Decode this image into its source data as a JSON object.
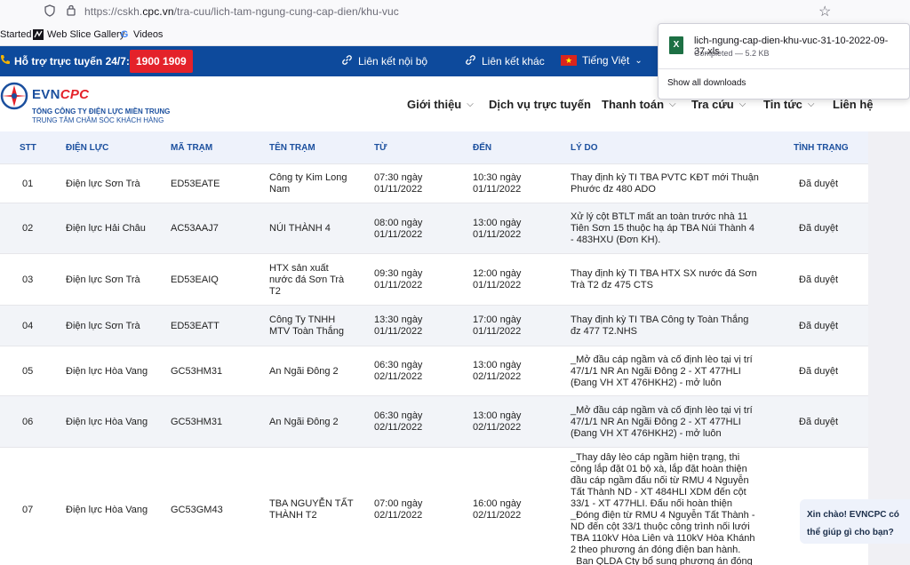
{
  "browser": {
    "url_prefix": "https://cskh.",
    "url_domain": "cpc.vn",
    "url_path": "/tra-cuu/lich-tam-ngung-cung-cap-dien/khu-vuc",
    "bookmarks": [
      {
        "label": "Started",
        "icon": "bookmark-icon"
      },
      {
        "label": "Web Slice Gallery",
        "icon": "web-slice-icon"
      },
      {
        "label": "Videos",
        "icon": "google-icon"
      }
    ]
  },
  "downloads": {
    "filename": "lich-ngung-cap-dien-khu-vuc-31-10-2022-09-37.xls",
    "status": "Completed — 5.2 KB",
    "show_all": "Show all downloads"
  },
  "topbar": {
    "support": "Hỗ trợ trực tuyến 24/7:",
    "hotline": "1900 1909",
    "internal_link": "Liên kết nội bộ",
    "external_link": "Liên kết khác",
    "language": "Tiếng Việt"
  },
  "header": {
    "logo_evn": "EVN",
    "logo_cpc": "CPC",
    "sub1": "TỔNG CÔNG TY ĐIỆN LỰC MIỀN TRUNG",
    "sub2": "TRUNG TÂM CHĂM SÓC KHÁCH HÀNG",
    "nav": [
      "Giới thiệu",
      "Dịch vụ trực tuyến",
      "Thanh toán",
      "Tra cứu",
      "Tin tức",
      "Liên hệ"
    ]
  },
  "table": {
    "headers": [
      "STT",
      "ĐIỆN LỰC",
      "MÃ TRẠM",
      "TÊN TRẠM",
      "TỪ",
      "ĐẾN",
      "LÝ DO",
      "TÌNH TRẠNG"
    ],
    "rows": [
      {
        "stt": "01",
        "dienluc": "Điện lực Sơn Trà",
        "ma": "ED53EATE",
        "ten": [
          "Công ty Kim Long",
          "Nam"
        ],
        "tu": [
          "07:30 ngày",
          "01/11/2022"
        ],
        "den": [
          "10:30 ngày",
          "01/11/2022"
        ],
        "lydo": [
          "Thay định kỳ TI TBA PVTC KĐT mới Thuận",
          "Phước đz 480 ADO"
        ],
        "tinhtrang": "Đã duyệt"
      },
      {
        "stt": "02",
        "dienluc": "Điện lực Hải Châu",
        "ma": "AC53AAJ7",
        "ten": [
          "NÚI THÀNH 4"
        ],
        "tu": [
          "08:00 ngày",
          "01/11/2022"
        ],
        "den": [
          "13:00 ngày",
          "01/11/2022"
        ],
        "lydo": [
          "Xử lý cột BTLT mất an toàn trước nhà 11",
          "Tiên Sơn 15 thuộc hạ áp TBA Núi Thành 4",
          "- 483HXU (Đơn KH)."
        ],
        "tinhtrang": "Đã duyệt"
      },
      {
        "stt": "03",
        "dienluc": "Điện lực Sơn Trà",
        "ma": "ED53EAIQ",
        "ten": [
          "HTX sản xuất",
          "nước đá Sơn Trà",
          "T2"
        ],
        "tu": [
          "09:30 ngày",
          "01/11/2022"
        ],
        "den": [
          "12:00 ngày",
          "01/11/2022"
        ],
        "lydo": [
          "Thay định kỳ TI TBA HTX SX nước đá Sơn",
          "Trà T2 đz 475 CTS"
        ],
        "tinhtrang": "Đã duyệt"
      },
      {
        "stt": "04",
        "dienluc": "Điện lực Sơn Trà",
        "ma": "ED53EATT",
        "ten": [
          "Công Ty TNHH",
          "MTV Toàn Thắng"
        ],
        "tu": [
          "13:30 ngày",
          "01/11/2022"
        ],
        "den": [
          "17:00 ngày",
          "01/11/2022"
        ],
        "lydo": [
          "Thay định kỳ TI TBA Công ty Toàn Thắng",
          "đz 477 T2.NHS"
        ],
        "tinhtrang": "Đã duyệt"
      },
      {
        "stt": "05",
        "dienluc": "Điện lực Hòa Vang",
        "ma": "GC53HM31",
        "ten": [
          "An Ngãi Đông 2"
        ],
        "tu": [
          "06:30 ngày",
          "02/11/2022"
        ],
        "den": [
          "13:00 ngày",
          "02/11/2022"
        ],
        "lydo": [
          "_Mở đầu cáp ngầm và cố định lèo tại vị trí",
          "47/1/1 NR An Ngãi Đông 2 - XT 477HLI",
          "(Đang VH XT 476HKH2) - mở luôn"
        ],
        "tinhtrang": "Đã duyệt"
      },
      {
        "stt": "06",
        "dienluc": "Điện lực Hòa Vang",
        "ma": "GC53HM31",
        "ten": [
          "An Ngãi Đông 2"
        ],
        "tu": [
          "06:30 ngày",
          "02/11/2022"
        ],
        "den": [
          "13:00 ngày",
          "02/11/2022"
        ],
        "lydo": [
          "_Mở đầu cáp ngầm và cố định lèo tại vị trí",
          "47/1/1 NR An Ngãi Đông 2 - XT 477HLI",
          "(Đang VH XT 476HKH2) - mở luôn"
        ],
        "tinhtrang": "Đã duyệt"
      },
      {
        "stt": "07",
        "dienluc": "Điện lực Hòa Vang",
        "ma": "GC53GM43",
        "ten": [
          "TBA NGUYỄN TẤT",
          "THÀNH T2"
        ],
        "tu": [
          "07:00 ngày",
          "02/11/2022"
        ],
        "den": [
          "16:00 ngày",
          "02/11/2022"
        ],
        "lydo": [
          "_Thay dây lèo cáp ngầm hiện trạng, thi",
          "công lắp đặt 01 bộ xà, lắp đặt hoàn thiện",
          "đầu cáp ngầm đấu nối từ RMU 4 Nguyễn",
          "Tất Thành ND - XT 484HLI XDM đến cột",
          "33/1 - XT 477HLI. Đấu nối hoàn thiện",
          "_Đóng điện từ RMU 4 Nguyễn Tất Thành -",
          "ND đến cột 33/1 thuộc công trình nối lưới",
          "TBA 110kV Hòa Liên và 110kV Hòa Khánh",
          "2 theo phương án đóng điện ban hành.",
          "_Ban QLDA Cty bổ sung phương án đóng"
        ],
        "tinhtrang": ""
      }
    ]
  },
  "chat": {
    "line1": "Xin chào! EVNCPC có",
    "line2": "thể giúp gì cho bạn?"
  }
}
